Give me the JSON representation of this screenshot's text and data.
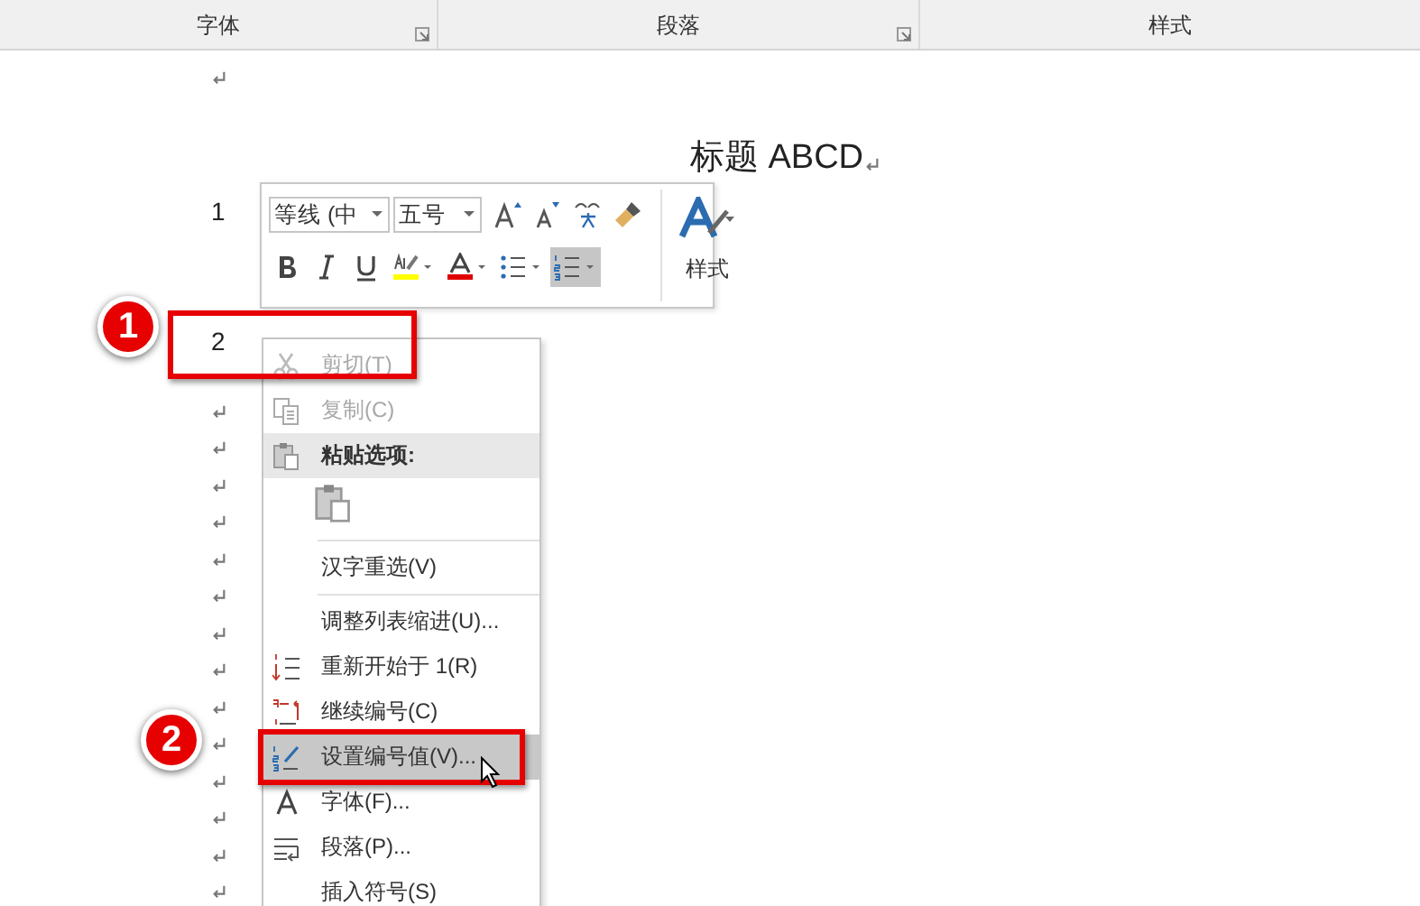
{
  "ribbon_groups": [
    {
      "label": "字体",
      "launcher": true
    },
    {
      "label": "段落",
      "launcher": true
    },
    {
      "label": "样式",
      "launcher": false
    }
  ],
  "document": {
    "title": "标题 ABCD",
    "list_numbers": [
      "1",
      "2"
    ]
  },
  "mini_toolbar": {
    "font_name": "等线 (中",
    "font_size": "五号",
    "styles_label": "样式",
    "numbering_selected": true
  },
  "context_menu": [
    {
      "kind": "item",
      "label": "剪切(T)",
      "disabled": true,
      "highlighted": false
    },
    {
      "kind": "item",
      "label": "复制(C)",
      "disabled": true,
      "highlighted": false
    },
    {
      "kind": "header",
      "label": "粘贴选项:"
    },
    {
      "kind": "paste-row"
    },
    {
      "kind": "separator"
    },
    {
      "kind": "item",
      "label": "汉字重选(V)",
      "disabled": false,
      "highlighted": false
    },
    {
      "kind": "separator"
    },
    {
      "kind": "item",
      "label": "调整列表缩进(U)...",
      "disabled": false,
      "highlighted": false
    },
    {
      "kind": "item",
      "label": "重新开始于 1(R)",
      "disabled": false,
      "highlighted": false
    },
    {
      "kind": "item",
      "label": "继续编号(C)",
      "disabled": false,
      "highlighted": false
    },
    {
      "kind": "item",
      "label": "设置编号值(V)...",
      "disabled": false,
      "highlighted": true
    },
    {
      "kind": "item",
      "label": "字体(F)...",
      "disabled": false,
      "highlighted": false
    },
    {
      "kind": "item",
      "label": "段落(P)...",
      "disabled": false,
      "highlighted": false
    },
    {
      "kind": "item",
      "label": "插入符号(S)",
      "disabled": false,
      "highlighted": false
    }
  ],
  "callouts": [
    "1",
    "2"
  ]
}
